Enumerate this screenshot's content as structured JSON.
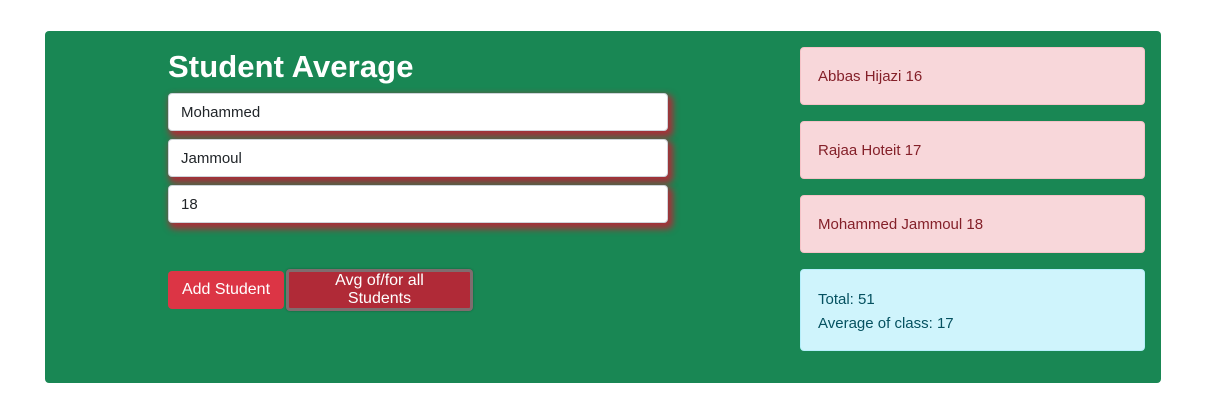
{
  "form": {
    "title": "Student Average",
    "first_name_value": "Mohammed",
    "last_name_value": "Jammoul",
    "grade_value": "18"
  },
  "buttons": {
    "add_label": "Add Student",
    "avg_label": "Avg of/for all Students"
  },
  "students": [
    {
      "text": "Abbas Hijazi 16"
    },
    {
      "text": "Rajaa Hoteit 17"
    },
    {
      "text": "Mohammed Jammoul 18"
    }
  ],
  "summary": {
    "total_text": "Total: 51",
    "average_text": "Average of class: 17"
  },
  "colors": {
    "panel": "#198754",
    "danger": "#dc3545",
    "danger_dark": "#b02a37",
    "alert_danger_bg": "#f8d7da",
    "alert_info_bg": "#cff4fc"
  }
}
